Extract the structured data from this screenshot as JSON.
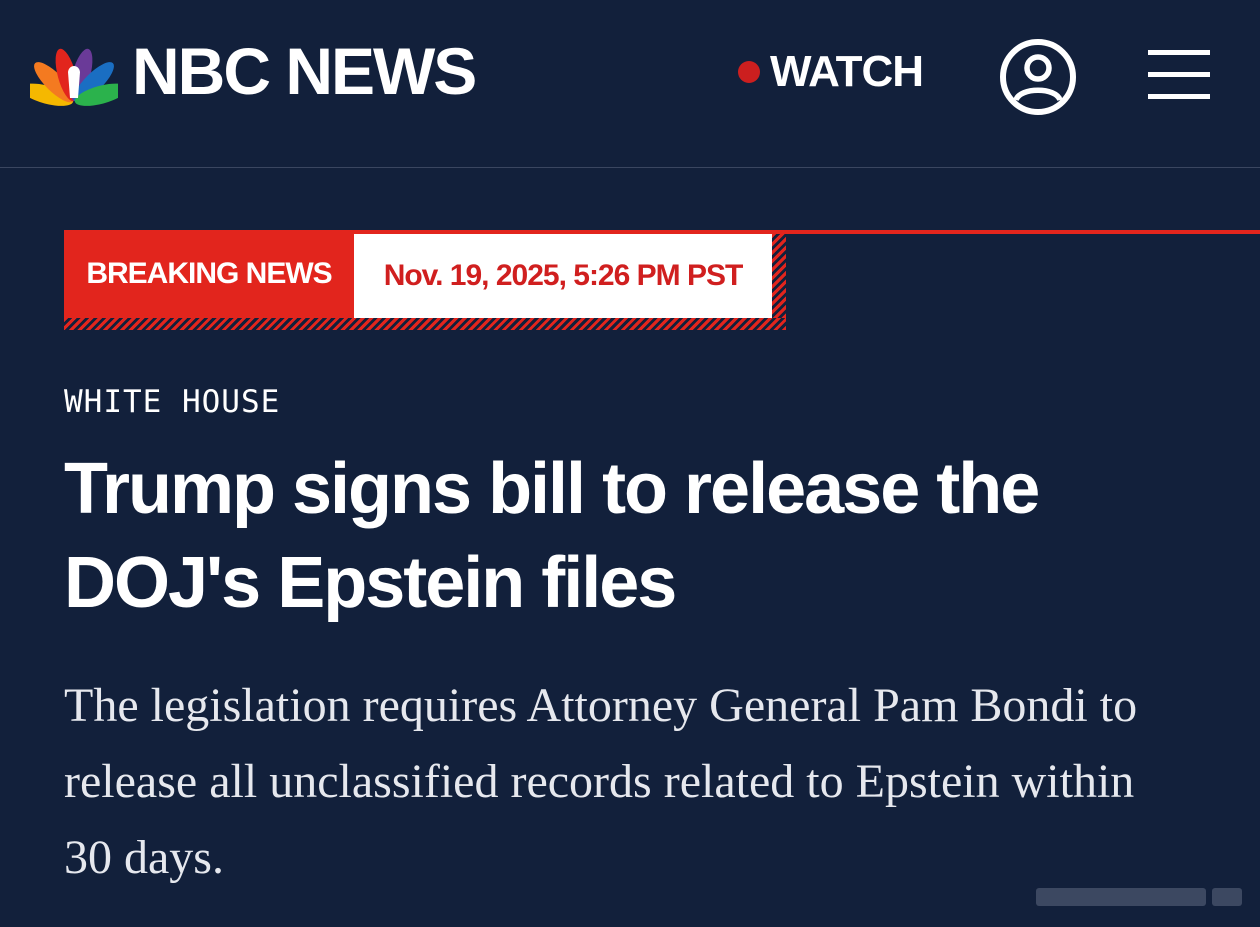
{
  "header": {
    "brand": "NBC NEWS",
    "watch_label": "WATCH",
    "icons": {
      "logo": "nbc-peacock-icon",
      "account": "user-circle-icon",
      "menu": "hamburger-menu-icon",
      "live": "live-dot-icon"
    }
  },
  "banner": {
    "label": "BREAKING NEWS",
    "timestamp": "Nov. 19, 2025, 5:26 PM PST"
  },
  "article": {
    "section": "WHITE HOUSE",
    "headline": "Trump signs bill to release the DOJ's Epstein files",
    "dek": "The legislation requires Attorney General Pam Bondi to release all unclassified records related to Epstein within 30 days."
  },
  "colors": {
    "background": "#12203b",
    "accent_red": "#e2251d",
    "timestamp_red": "#d01f1f",
    "text": "#ffffff",
    "peacock": [
      "#f5b800",
      "#f47a20",
      "#e2251d",
      "#6a3a98",
      "#1a6ec2",
      "#2bb24c"
    ]
  }
}
